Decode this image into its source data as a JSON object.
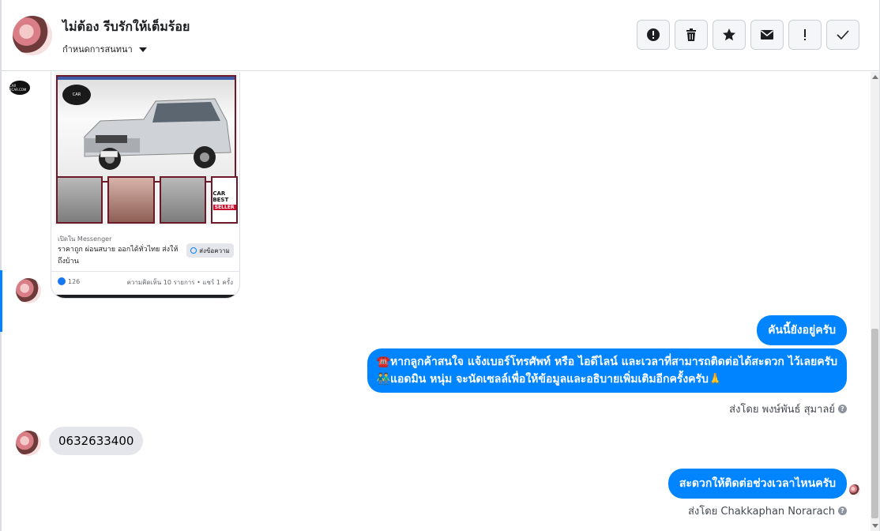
{
  "header": {
    "name": "ไม่ต้อง รีบรักให้เต็มร้อย",
    "subtitle": "กำหนดการสนทนา",
    "toolbar": [
      {
        "name": "mark-spam-button",
        "icon": "alert-circle-icon"
      },
      {
        "name": "delete-button",
        "icon": "trash-icon"
      },
      {
        "name": "star-button",
        "icon": "star-icon"
      },
      {
        "name": "mark-unread-button",
        "icon": "envelope-icon"
      },
      {
        "name": "follow-up-button",
        "icon": "exclamation-icon"
      },
      {
        "name": "mark-done-button",
        "icon": "check-icon"
      }
    ]
  },
  "ad": {
    "logo_text": "CAR 2CAR.COM",
    "best_seller_top": "CAR BEST",
    "best_seller_bottom": "SELLER",
    "open_in": "เปิดใน Messenger",
    "title": "ราคาถูก ผ่อนสบาย ออกได้ทั่วไทย ส่งให้ถึงบ้าน",
    "send_label": "ส่งข้อความ",
    "likes": "126",
    "stats": "ความคิดเห็น 10 รายการ • แชร์ 1 ครั้ง"
  },
  "messages": {
    "out1": "คันนี้ยังอยู่ครับ",
    "out2_line1": "☎️หากลูกค้าสนใจ แจ้งเบอร์โทรศัพท์ หรือ ไอดีไลน์ และเวลาที่สามารถติดต่อได้สะดวก ไว้เลยครับ",
    "out2_line2": "👬แอดมิน หนุ่ม จะนัดเซลล์เพื่อให้ข้อมูลและอธิบายเพิ่มเติมอีกครั้งครับ🙏",
    "sent_by_1": "ส่งโดย พงษ์พันธ์ สุมาลย์",
    "in1": "0632633400",
    "out3": "สะดวกให้ติดต่อช่วงเวลาไหนครับ",
    "sent_by_2": "ส่งโดย Chakkaphan Norarach"
  },
  "colors": {
    "outgoing_bubble": "#0084ff",
    "incoming_bubble": "#e4e6eb",
    "ad_border": "#6b1a2a"
  }
}
